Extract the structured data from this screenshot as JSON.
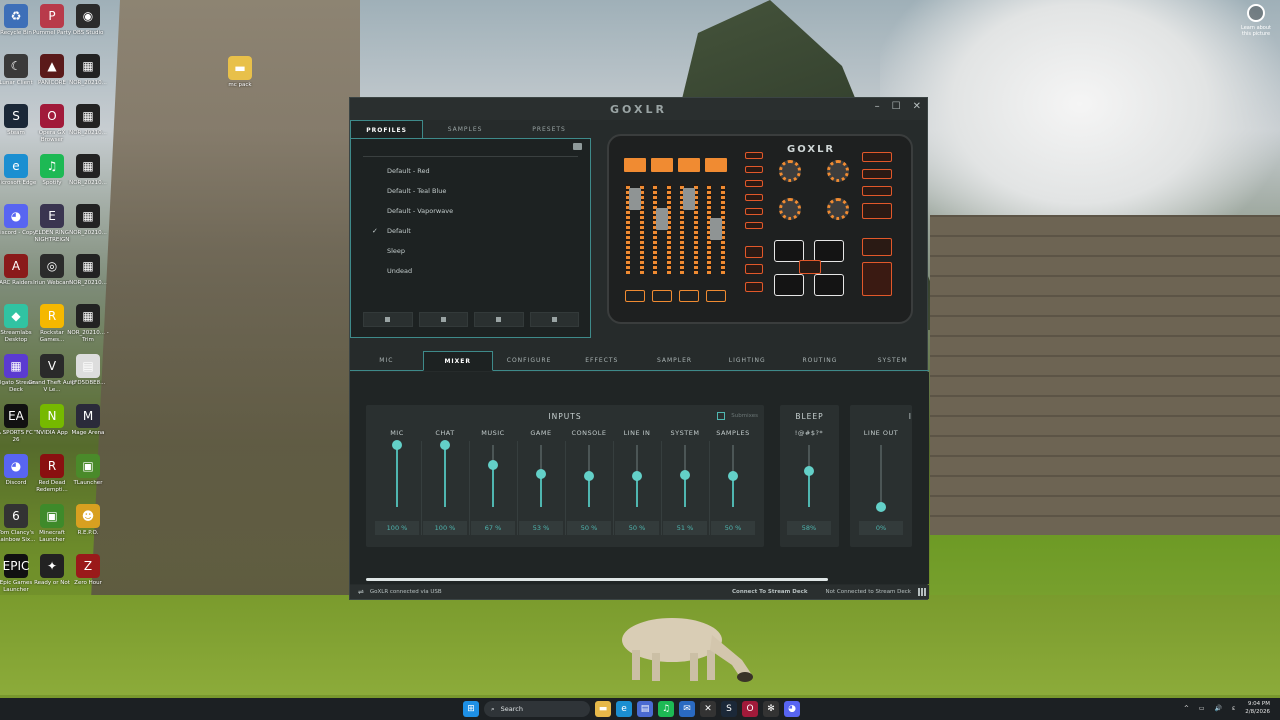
{
  "desktop": {
    "icons": [
      {
        "label": "Recycle Bin",
        "color": "#3d6fb8",
        "glyph": "♻"
      },
      {
        "label": "Pummel Party",
        "color": "#b83a4a",
        "glyph": "P"
      },
      {
        "label": "OBS Studio",
        "color": "#2b2b2b",
        "glyph": "◉"
      },
      {
        "label": "Lunar Client",
        "color": "#3a3a3a",
        "glyph": "☾"
      },
      {
        "label": "PANICORE",
        "color": "#5a1a1a",
        "glyph": "▲"
      },
      {
        "label": "NOR_20210...",
        "color": "#222",
        "glyph": "▦"
      },
      {
        "label": "Steam",
        "color": "#1b2838",
        "glyph": "S"
      },
      {
        "label": "Opera GX Browser",
        "color": "#a11a3a",
        "glyph": "O"
      },
      {
        "label": "NOR_20210...",
        "color": "#222",
        "glyph": "▦"
      },
      {
        "label": "Microsoft Edge",
        "color": "#1b8fd1",
        "glyph": "e"
      },
      {
        "label": "Spotify",
        "color": "#1db954",
        "glyph": "♫"
      },
      {
        "label": "NOR_20210...",
        "color": "#222",
        "glyph": "▦"
      },
      {
        "label": "Discord - Copy",
        "color": "#5865f2",
        "glyph": "◕"
      },
      {
        "label": "ELDEN RING NIGHTREIGN",
        "color": "#3a3550",
        "glyph": "E"
      },
      {
        "label": "NOR_20210...",
        "color": "#222",
        "glyph": "▦"
      },
      {
        "label": "ARC Raiders",
        "color": "#8a1a1a",
        "glyph": "A"
      },
      {
        "label": "Iriun Webcam",
        "color": "#2b2b2b",
        "glyph": "◎"
      },
      {
        "label": "NOR_20210...",
        "color": "#222",
        "glyph": "▦"
      },
      {
        "label": "Streamlabs Desktop",
        "color": "#31c3a2",
        "glyph": "◆"
      },
      {
        "label": "Rockstar Games...",
        "color": "#f5b800",
        "glyph": "R"
      },
      {
        "label": "NOR_20210... - Trim",
        "color": "#222",
        "glyph": "▦"
      },
      {
        "label": "Elgato Stream Deck",
        "color": "#5b3bd1",
        "glyph": "▦"
      },
      {
        "label": "Grand Theft Auto V Le...",
        "color": "#2a2a2a",
        "glyph": "V"
      },
      {
        "label": "{FD5DBE8...",
        "color": "#ddd",
        "glyph": "▤"
      },
      {
        "label": "EA SPORTS FC™ 26",
        "color": "#111",
        "glyph": "EA"
      },
      {
        "label": "NVIDIA App",
        "color": "#76b900",
        "glyph": "N"
      },
      {
        "label": "Mage Arena",
        "color": "#2a2a3a",
        "glyph": "M"
      },
      {
        "label": "Discord",
        "color": "#5865f2",
        "glyph": "◕"
      },
      {
        "label": "Red Dead Redempti...",
        "color": "#8a1010",
        "glyph": "R"
      },
      {
        "label": "TLauncher",
        "color": "#4a8a2a",
        "glyph": "▣"
      },
      {
        "label": "Tom Clancy's Rainbow Six...",
        "color": "#333",
        "glyph": "6"
      },
      {
        "label": "Minecraft Launcher",
        "color": "#3e8a2a",
        "glyph": "▣"
      },
      {
        "label": "R.E.P.O.",
        "color": "#d8a020",
        "glyph": "☻"
      },
      {
        "label": "Epic Games Launcher",
        "color": "#111",
        "glyph": "EPIC"
      },
      {
        "label": "Ready or Not",
        "color": "#222",
        "glyph": "✦"
      },
      {
        "label": "Zero Hour",
        "color": "#9a1a1a",
        "glyph": "Z"
      }
    ],
    "mc_pack": "mc pack",
    "learn_picture": "Learn about this picture"
  },
  "app": {
    "title": "GOXLR",
    "device_logo": "GOXLR",
    "window_controls": [
      "–",
      "☐",
      "✕"
    ],
    "profile_tabs": [
      "PROFILES",
      "SAMPLES",
      "PRESETS"
    ],
    "profiles": [
      {
        "name": "Default - Red",
        "checked": false
      },
      {
        "name": "Default - Teal Blue",
        "checked": false
      },
      {
        "name": "Default - Vaporwave",
        "checked": false
      },
      {
        "name": "Default",
        "checked": true
      },
      {
        "name": "Sleep",
        "checked": false
      },
      {
        "name": "Undead",
        "checked": false
      }
    ],
    "check_mark": "✓",
    "main_tabs": [
      "MIC",
      "MIXER",
      "CONFIGURE",
      "EFFECTS",
      "SAMPLER",
      "LIGHTING",
      "ROUTING",
      "SYSTEM"
    ],
    "active_main_tab": "MIXER",
    "mixer": {
      "inputs_title": "INPUTS",
      "submixes_label": "Submixes",
      "channels": [
        {
          "name": "MIC",
          "value": "100 %",
          "level": 1.0
        },
        {
          "name": "CHAT",
          "value": "100 %",
          "level": 1.0
        },
        {
          "name": "MUSIC",
          "value": "67 %",
          "level": 0.67
        },
        {
          "name": "GAME",
          "value": "53 %",
          "level": 0.53
        },
        {
          "name": "CONSOLE",
          "value": "50 %",
          "level": 0.5
        },
        {
          "name": "LINE IN",
          "value": "50 %",
          "level": 0.5
        },
        {
          "name": "SYSTEM",
          "value": "51 %",
          "level": 0.51
        },
        {
          "name": "SAMPLES",
          "value": "50 %",
          "level": 0.5
        }
      ],
      "bleep": {
        "title": "BLEEP",
        "name": "!@#$?*",
        "value": "58%",
        "level": 0.58
      },
      "outputs": {
        "title": "I",
        "name": "LINE OUT",
        "value": "0%",
        "level": 0.0
      }
    },
    "status": {
      "connection": "GoXLR connected via USB",
      "stream_deck_button": "Connect To Stream Deck",
      "stream_deck_status": "Not Connected to Stream Deck"
    }
  },
  "taskbar": {
    "search_label": "Search",
    "time": "9:04 PM",
    "date": "2/8/2026",
    "tray_items": [
      "^",
      "▭",
      "🔊",
      "ɛ"
    ]
  }
}
